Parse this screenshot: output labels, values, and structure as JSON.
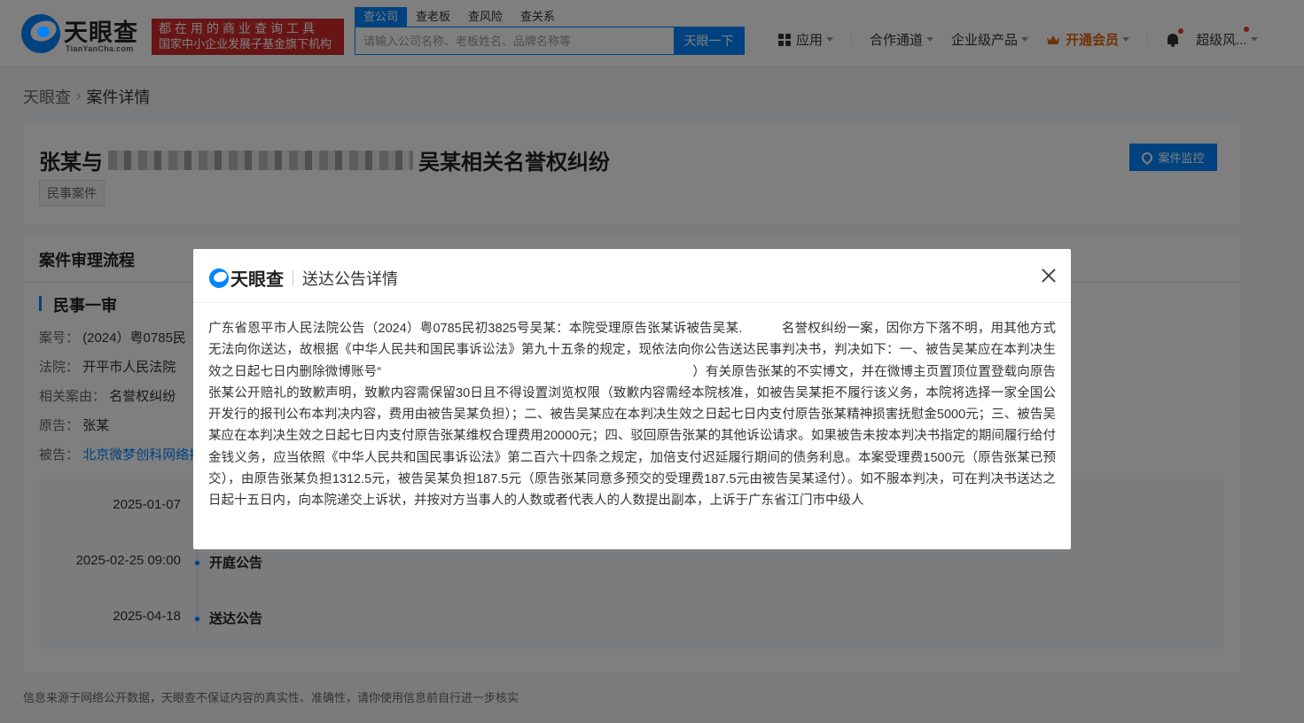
{
  "header": {
    "logo_text": "天眼查",
    "logo_sub": "TianYanCha.com",
    "slogan_line1": "都在用的商业查询工具",
    "slogan_line2": "国家中小企业发展子基金旗下机构",
    "search_tabs": [
      "查公司",
      "查老板",
      "查风险",
      "查关系"
    ],
    "search_placeholder": "请输入公司名称、老板姓名、品牌名称等",
    "search_button": "天眼一下",
    "nav": {
      "apps": "应用",
      "partner": "合作通道",
      "enterprise": "企业级产品",
      "vip": "开通会员",
      "user": "超级风..."
    }
  },
  "breadcrumb": {
    "home": "天眼查",
    "separator": "›",
    "current": "案件详情"
  },
  "case": {
    "title_prefix": "张某与",
    "title_suffix": "吴某相关名誉权纠纷",
    "tag": "民事案件",
    "monitor_button": "案件监控"
  },
  "process": {
    "title": "案件审理流程",
    "stage": "民事一审",
    "case_no_label": "案号：",
    "case_no": "(2024）粤0785民",
    "court_label": "法院：",
    "court": "开平市人民法院",
    "cause_label": "相关案由：",
    "cause": "名誉权纠纷",
    "plaintiff_label": "原告：",
    "plaintiff": "张某",
    "defendant_label": "被告：",
    "defendant": "北京微梦创科网络技",
    "timeline": [
      {
        "date": "2025-01-07",
        "event": ""
      },
      {
        "date": "2025-02-25 09:00",
        "event": "开庭公告"
      },
      {
        "date": "2025-04-18",
        "event": "送达公告"
      }
    ]
  },
  "footer": {
    "note": "信息来源于网络公开数据，天眼查不保证内容的真实性、准确性，请你使用信息前自行进一步核实"
  },
  "modal": {
    "logo_text": "天眼查",
    "title": "送达公告详情",
    "body": "广东省恩平市人民法院公告（2024）粤0785民初3825号吴某：本院受理原告张某诉被告吴某.　　　名誉权纠纷一案，因你方下落不明，用其他方式无法向你送达，故根据《中华人民共和国民事诉讼法》第九十五条的规定，现依法向你公告送达民事判决书，判决如下：一、被告吴某应在本判决生效之日起七日内删除微博账号“　　　　　　　　　　　　　　　　　　　　　　　　）有关原告张某的不实博文，并在微博主页置顶位置登载向原告张某公开赔礼的致歉声明，致歉内容需保留30日且不得设置浏览权限（致歉内容需经本院核准，如被告吴某拒不履行该义务，本院将选择一家全国公开发行的报刊公布本判决内容，费用由被告吴某负担）；二、被告吴某应在本判决生效之日起七日内支付原告张某精神损害抚慰金5000元；三、被告吴某应在本判决生效之日起七日内支付原告张某维权合理费用20000元；四、驳回原告张某的其他诉讼请求。如果被告未按本判决书指定的期间履行给付金钱义务，应当依照《中华人民共和国民事诉讼法》第二百六十四条之规定，加倍支付迟延履行期间的债务利息。本案受理费1500元（原告张某已预交），由原告张某负担1312.5元，被告吴某负担187.5元（原告张某同意多预交的受理费187.5元由被告吴某迳付）。如不服本判决，可在判决书送达之日起十五日内，向本院递交上诉状，并按对方当事人的人数或者代表人的人数提出副本，上诉于广东省江门市中级人"
  },
  "colors": {
    "brand": "#0084ff",
    "slogan_bg": "#d12a2c",
    "vip": "#e0620d"
  }
}
